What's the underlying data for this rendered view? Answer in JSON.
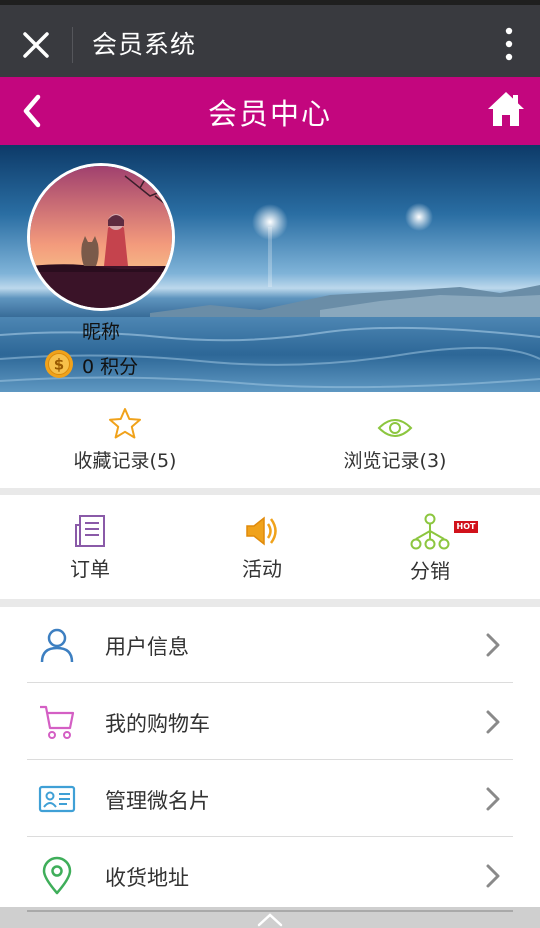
{
  "wechat": {
    "title": "会员系统"
  },
  "header": {
    "title": "会员中心"
  },
  "profile": {
    "nickname": "昵称",
    "points_value": "0",
    "points_unit": "积分"
  },
  "records": [
    {
      "label": "收藏记录(5)"
    },
    {
      "label": "浏览记录(3)"
    }
  ],
  "quick": [
    {
      "label": "订单"
    },
    {
      "label": "活动"
    },
    {
      "label": "分销",
      "badge": "HOT"
    }
  ],
  "menu": [
    {
      "label": "用户信息"
    },
    {
      "label": "我的购物车"
    },
    {
      "label": "管理微名片"
    },
    {
      "label": "收货地址"
    }
  ],
  "colors": {
    "header": "#c3067e",
    "wechat_bar": "#393a3f",
    "accent_orange": "#f0a21b",
    "accent_green": "#8cc63f"
  }
}
